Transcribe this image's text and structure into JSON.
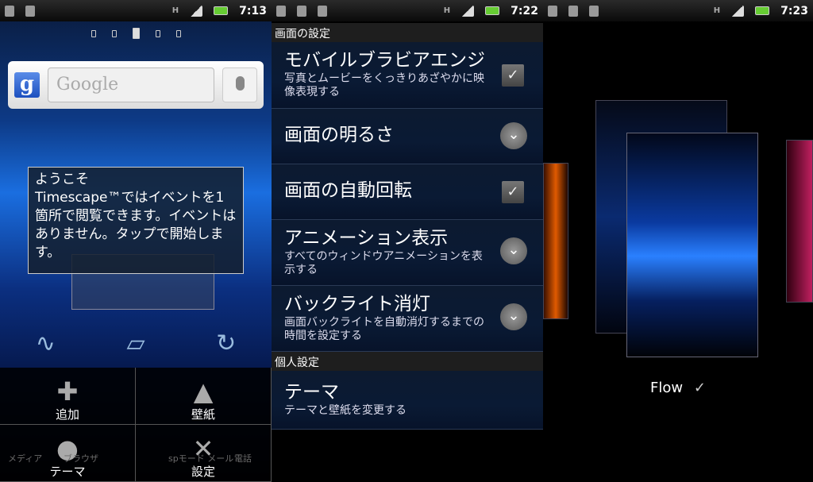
{
  "screens": [
    {
      "status": {
        "time": "7:13",
        "network": "H"
      },
      "search": {
        "placeholder": "Google"
      },
      "widget": {
        "title": "ようこそ",
        "body": "Timescape™ではイベントを1箇所で閲覧できます。イベントはありません。タップで開始します。"
      },
      "menu": [
        {
          "label": "追加",
          "icon": "plus-icon"
        },
        {
          "label": "壁紙",
          "icon": "wallpaper-icon"
        },
        {
          "label": "テーマ",
          "icon": "palette-icon"
        },
        {
          "label": "設定",
          "icon": "wrench-icon"
        }
      ],
      "dock": [
        "メディア",
        "ブラウザ",
        "spモード メール",
        "電話"
      ],
      "page_indicator": {
        "pages": 5,
        "current": 3
      }
    },
    {
      "status": {
        "time": "7:22",
        "network": "H"
      },
      "sections": [
        {
          "header": "画面の設定"
        },
        {
          "header": "個人設定"
        }
      ],
      "settings": [
        {
          "title": "モバイルブラビアエンジ",
          "summary": "写真とムービーをくっきりあざやかに映像表現する",
          "control": "checkbox",
          "checked": true
        },
        {
          "title": "画面の明るさ",
          "summary": "",
          "control": "chevron"
        },
        {
          "title": "画面の自動回転",
          "summary": "",
          "control": "checkbox",
          "checked": true
        },
        {
          "title": "アニメーション表示",
          "summary": "すべてのウィンドウアニメーションを表示する",
          "control": "chevron"
        },
        {
          "title": "バックライト消灯",
          "summary": "画面バックライトを自動消灯するまでの時間を設定する",
          "control": "chevron"
        },
        {
          "title": "テーマ",
          "summary": "テーマと壁紙を変更する",
          "control": "none"
        }
      ]
    },
    {
      "status": {
        "time": "7:23",
        "network": "H"
      },
      "theme": {
        "name": "Flow",
        "selected_mark": "✓"
      }
    }
  ],
  "colors": {
    "accent": "#1a6ee0",
    "list_bg": "#0c1a30"
  }
}
